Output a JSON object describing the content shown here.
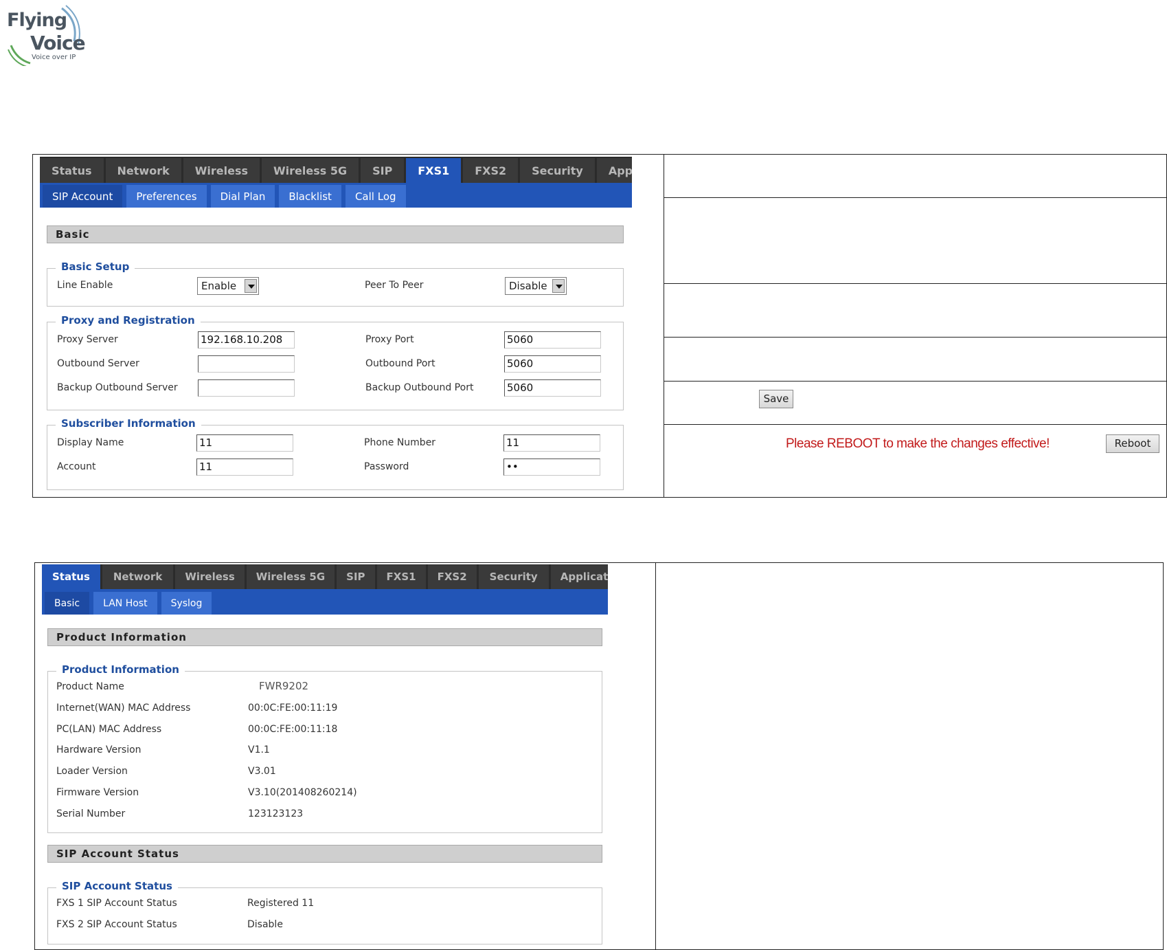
{
  "logo": {
    "line1": "Flying",
    "line2": "Voice",
    "tagline": "Voice over IP"
  },
  "panel1": {
    "tabs": [
      "Status",
      "Network",
      "Wireless",
      "Wireless 5G",
      "SIP",
      "FXS1",
      "FXS2",
      "Security",
      "Applicatio"
    ],
    "active_tab": "FXS1",
    "subtabs": [
      "SIP Account",
      "Preferences",
      "Dial Plan",
      "Blacklist",
      "Call Log"
    ],
    "active_subtab": "SIP Account",
    "section_title": "Basic",
    "basic_setup": {
      "legend": "Basic Setup",
      "line_enable_label": "Line Enable",
      "line_enable_value": "Enable",
      "peer_label": "Peer To Peer",
      "peer_value": "Disable"
    },
    "proxy": {
      "legend": "Proxy and Registration",
      "proxy_server_label": "Proxy Server",
      "proxy_server_value": "192.168.10.208",
      "proxy_port_label": "Proxy Port",
      "proxy_port_value": "5060",
      "outbound_server_label": "Outbound Server",
      "outbound_server_value": "",
      "outbound_port_label": "Outbound Port",
      "outbound_port_value": "5060",
      "backup_server_label": "Backup Outbound Server",
      "backup_server_value": "",
      "backup_port_label": "Backup Outbound Port",
      "backup_port_value": "5060"
    },
    "subscriber": {
      "legend": "Subscriber Information",
      "display_name_label": "Display Name",
      "display_name_value": "11",
      "phone_label": "Phone Number",
      "phone_value": "11",
      "account_label": "Account",
      "account_value": "11",
      "password_label": "Password",
      "password_value": "••"
    }
  },
  "side_actions": {
    "save_label": "Save",
    "reboot_notice": "Please REBOOT to make the changes effective!",
    "reboot_label": "Reboot"
  },
  "panel2": {
    "tabs": [
      "Status",
      "Network",
      "Wireless",
      "Wireless 5G",
      "SIP",
      "FXS1",
      "FXS2",
      "Security",
      "Applicatio"
    ],
    "active_tab": "Status",
    "subtabs": [
      "Basic",
      "LAN Host",
      "Syslog"
    ],
    "active_subtab": "Basic",
    "section1_title": "Product Information",
    "product_legend": "Product Information",
    "product_rows": [
      {
        "label": "Product Name",
        "value": "FWR9202"
      },
      {
        "label": "Internet(WAN) MAC Address",
        "value": "00:0C:FE:00:11:19"
      },
      {
        "label": "PC(LAN) MAC Address",
        "value": "00:0C:FE:00:11:18"
      },
      {
        "label": "Hardware Version",
        "value": "V1.1"
      },
      {
        "label": "Loader Version",
        "value": "V3.01"
      },
      {
        "label": "Firmware Version",
        "value": "V3.10(201408260214)"
      },
      {
        "label": "Serial Number",
        "value": "123123123"
      }
    ],
    "section2_title": "SIP Account Status",
    "sip_legend": "SIP Account Status",
    "sip_rows": [
      {
        "label": "FXS 1 SIP Account Status",
        "value": "Registered 11"
      },
      {
        "label": "FXS 2 SIP Account Status",
        "value": "Disable"
      }
    ]
  },
  "colors": {
    "tab_bar": "#2b2b2b",
    "active_tab": "#2255b7",
    "legend_text": "#1f4e9e",
    "notice_text": "#c21b1b"
  }
}
